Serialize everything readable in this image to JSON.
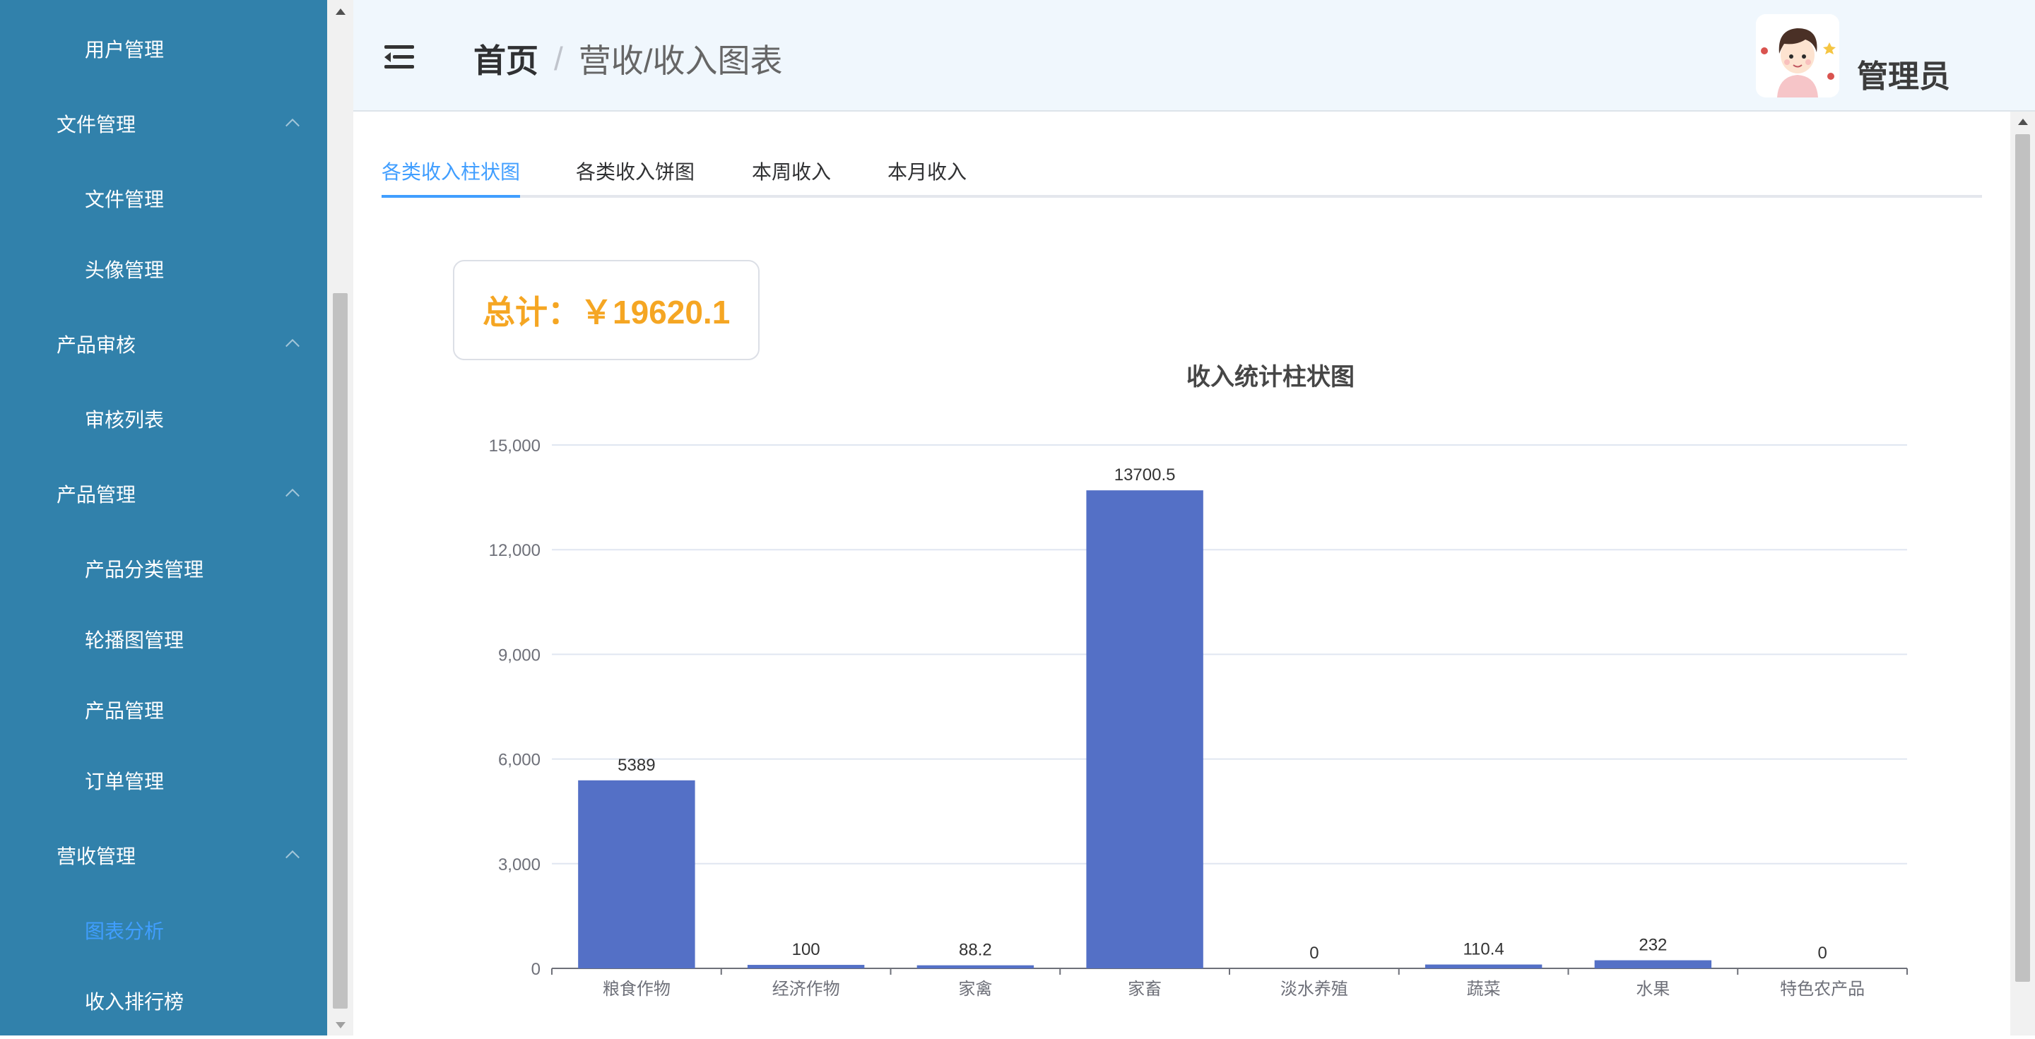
{
  "sidebar": {
    "items": [
      {
        "label": "用户管理",
        "type": "sub"
      },
      {
        "label": "文件管理",
        "type": "group"
      },
      {
        "label": "文件管理",
        "type": "sub"
      },
      {
        "label": "头像管理",
        "type": "sub"
      },
      {
        "label": "产品审核",
        "type": "group"
      },
      {
        "label": "审核列表",
        "type": "sub"
      },
      {
        "label": "产品管理",
        "type": "group"
      },
      {
        "label": "产品分类管理",
        "type": "sub"
      },
      {
        "label": "轮播图管理",
        "type": "sub"
      },
      {
        "label": "产品管理",
        "type": "sub"
      },
      {
        "label": "订单管理",
        "type": "sub"
      },
      {
        "label": "营收管理",
        "type": "group"
      },
      {
        "label": "图表分析",
        "type": "sub",
        "active": true
      },
      {
        "label": "收入排行榜",
        "type": "sub"
      }
    ]
  },
  "header": {
    "breadcrumb_home": "首页",
    "breadcrumb_separator": "/",
    "breadcrumb_current": "营收/收入图表",
    "username": "管理员",
    "menu_icon": "menu-fold-icon",
    "avatar_icon": "user-avatar"
  },
  "tabs": [
    {
      "label": "各类收入柱状图",
      "active": true
    },
    {
      "label": "各类收入饼图"
    },
    {
      "label": "本周收入"
    },
    {
      "label": "本月收入"
    }
  ],
  "total": {
    "text": "总计：￥19620.1"
  },
  "colors": {
    "sidebar_bg": "#3181ab",
    "accent": "#409eff",
    "bar": "#5470c6",
    "total_text": "#f5a623"
  },
  "chart_data": {
    "type": "bar",
    "title": "收入统计柱状图",
    "categories": [
      "粮食作物",
      "经济作物",
      "家禽",
      "家畜",
      "淡水养殖",
      "蔬菜",
      "水果",
      "特色农产品"
    ],
    "values": [
      5389,
      100,
      88.2,
      13700.5,
      0,
      110.4,
      232,
      0
    ],
    "value_labels": [
      "5389",
      "100",
      "88.2",
      "13700.5",
      "0",
      "110.4",
      "232",
      "0"
    ],
    "y_ticks": [
      "0",
      "3,000",
      "6,000",
      "9,000",
      "12,000",
      "15,000"
    ],
    "ylim": [
      0,
      15000
    ],
    "grid": true,
    "xlabel": "",
    "ylabel": ""
  }
}
